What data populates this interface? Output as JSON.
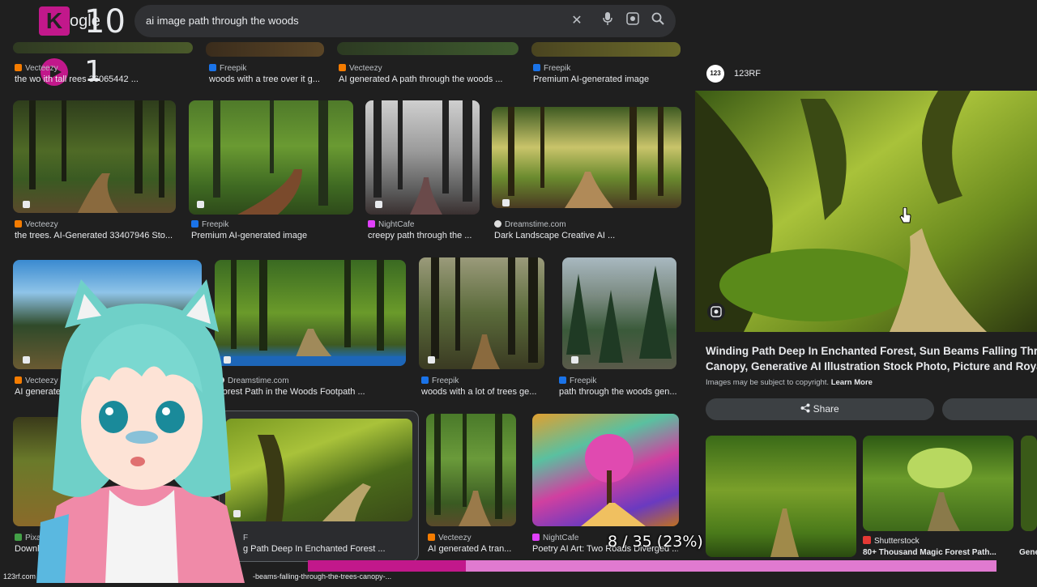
{
  "search": {
    "logo_letter": "K",
    "logo_text": "ogle",
    "overlay_counter_top": "10",
    "overlay_counter_bottom": "1",
    "query": "ai image path through the woods",
    "icons": [
      "close-icon",
      "mic-icon",
      "lens-icon",
      "search-icon"
    ]
  },
  "row0": [
    {
      "source": "Vecteezy",
      "title": "the wo  ith tall  rees 36065442 ...",
      "fav_color": "#f57c00"
    },
    {
      "source": "Freepik",
      "title": "woods with a tree over it g...",
      "fav_color": "#1a73e8"
    },
    {
      "source": "Vecteezy",
      "title": "AI generated A path through the woods ...",
      "fav_color": "#f57c00"
    },
    {
      "source": "Freepik",
      "title": "Premium AI-generated image",
      "fav_color": "#1a73e8"
    }
  ],
  "row1": [
    {
      "source": "Vecteezy",
      "title": "the trees. AI-Generated 33407946 Sto...",
      "fav_color": "#f57c00"
    },
    {
      "source": "Freepik",
      "title": "Premium AI-generated image",
      "fav_color": "#1a73e8"
    },
    {
      "source": "NightCafe",
      "title": "creepy path through the ...",
      "fav_color": "#e040fb"
    },
    {
      "source": "Dreamstime.com",
      "title": "Dark Landscape Creative AI ...",
      "fav_color": "#dddddd"
    }
  ],
  "row2": [
    {
      "source": "Vecteezy",
      "title": "AI generated",
      "fav_color": "#f57c00"
    },
    {
      "source": "Dreamstime.com",
      "title": "Forest Path in the Woods Footpath ...",
      "fav_color": "#dddddd"
    },
    {
      "source": "Freepik",
      "title": "woods with a lot of trees ge...",
      "fav_color": "#1a73e8"
    },
    {
      "source": "Freepik",
      "title": "path through the woods gen...",
      "fav_color": "#1a73e8"
    }
  ],
  "row3": [
    {
      "source": "Pixab",
      "title": "Downl",
      "fav_color": "#43a047"
    },
    {
      "source": "F",
      "title": "g Path Deep In Enchanted Forest ...",
      "fav_color": "#1a73e8"
    },
    {
      "source": "Vecteezy",
      "title": "AI generated A tran...",
      "fav_color": "#f57c00"
    },
    {
      "source": "NightCafe",
      "title": "Poetry AI Art: Two Roads Diverged ...",
      "fav_color": "#e040fb"
    }
  ],
  "panel": {
    "site_logo": "123",
    "site_name": "123RF",
    "title_line1": "Winding Path Deep In Enchanted Forest, Sun Beams Falling Throug",
    "title_line2": "Canopy, Generative AI Illustration Stock Photo, Picture and Royalt",
    "copyright": "Images may be subject to copyright.",
    "learn_more": "Learn More",
    "share_label": "Share",
    "related": [
      {
        "source": "Shutterstock",
        "title": "80+ Thousand Magic Forest Path..."
      },
      {
        "source": "",
        "title": "Gene"
      }
    ]
  },
  "progress": {
    "text": "8 / 35 (23%)",
    "fraction": 0.23
  },
  "footer": {
    "left": "123rf.com",
    "url": "-beams-falling-through-the-trees-canopy-..."
  }
}
